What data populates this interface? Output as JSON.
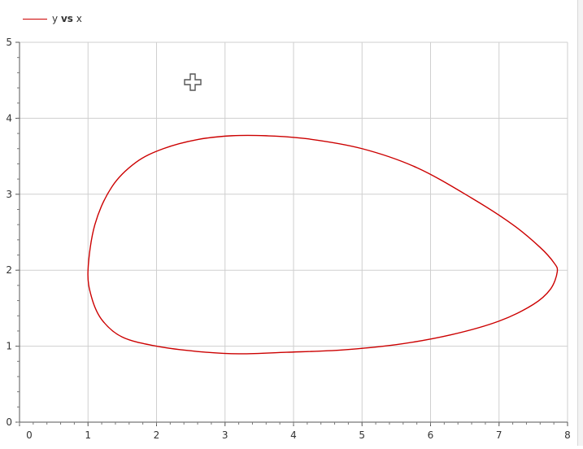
{
  "legend": {
    "label_prefix": "y",
    "label_bold": "vs",
    "label_suffix": "x"
  },
  "cursor": {
    "icon": "crosshair-plus-icon"
  },
  "chart_data": {
    "type": "line",
    "title": "",
    "xlabel": "",
    "ylabel": "",
    "xlim": [
      0,
      8
    ],
    "ylim": [
      0,
      5
    ],
    "xticks": [
      0,
      1,
      2,
      3,
      4,
      5,
      6,
      7,
      8
    ],
    "yticks": [
      0,
      1,
      2,
      3,
      4,
      5
    ],
    "grid": true,
    "legend_position": "top-left",
    "series": [
      {
        "name": "y vs x",
        "color": "#cc0000",
        "x": [
          1.0,
          1.1,
          1.35,
          1.7,
          2.1,
          2.6,
          3.1,
          3.6,
          4.2,
          5.0,
          5.8,
          6.6,
          7.2,
          7.6,
          7.8,
          7.85,
          7.75,
          7.5,
          7.0,
          6.3,
          5.5,
          4.7,
          3.9,
          3.2,
          2.6,
          2.0,
          1.5,
          1.2,
          1.05,
          1.0
        ],
        "y": [
          2.0,
          2.6,
          3.1,
          3.42,
          3.6,
          3.72,
          3.77,
          3.77,
          3.73,
          3.6,
          3.35,
          2.95,
          2.6,
          2.3,
          2.1,
          1.98,
          1.75,
          1.55,
          1.33,
          1.15,
          1.02,
          0.95,
          0.92,
          0.9,
          0.93,
          1.0,
          1.12,
          1.35,
          1.65,
          2.0
        ]
      }
    ]
  }
}
